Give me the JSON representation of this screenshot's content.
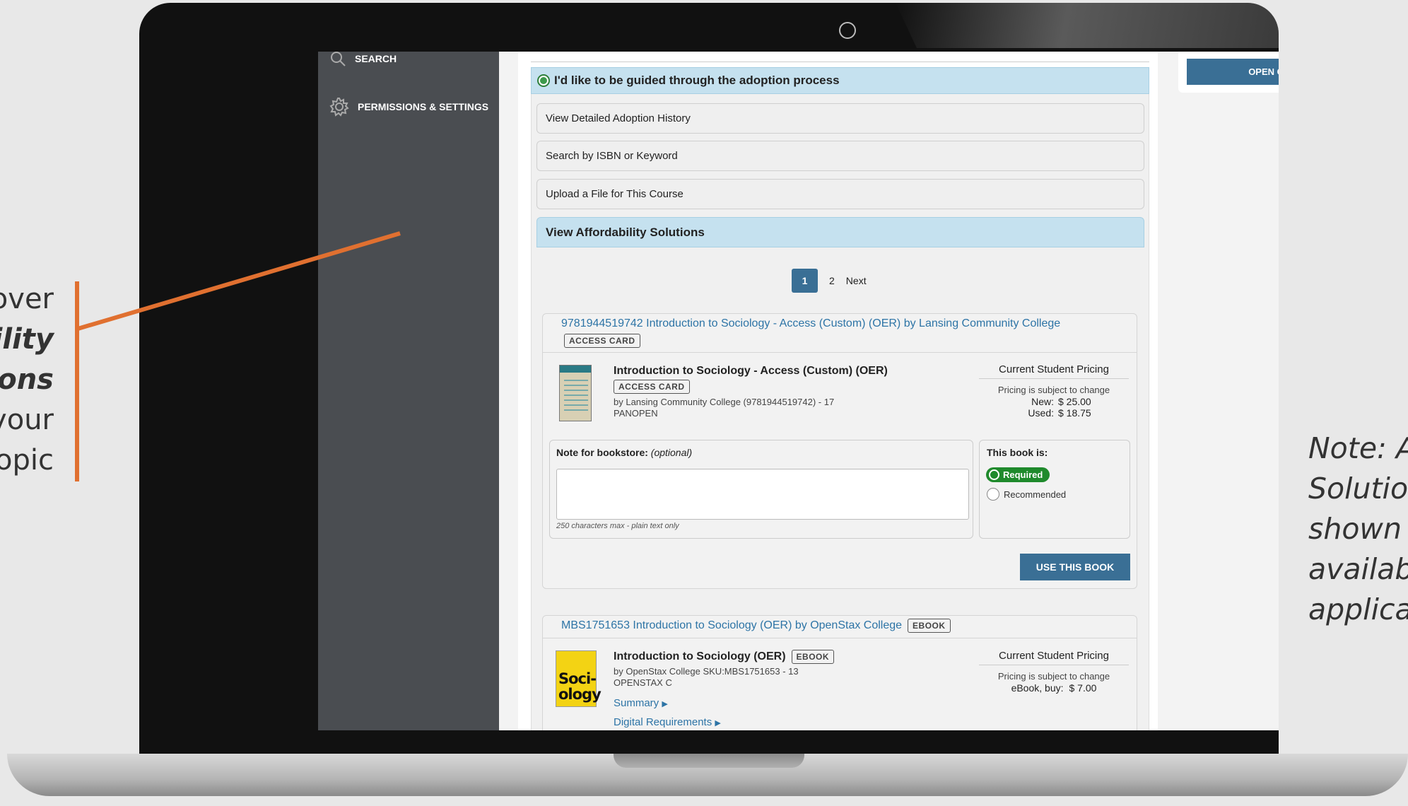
{
  "annotation_left": {
    "lines": [
      "over",
      "ility",
      "ions",
      "your",
      "opic"
    ]
  },
  "annotation_right": {
    "lines": [
      "Note: A",
      "Solutior",
      "shown i",
      "availab",
      "applica"
    ]
  },
  "sidebar": {
    "items": [
      {
        "label": "SEARCH",
        "icon": "search-icon"
      },
      {
        "label": "PERMISSIONS & SETTINGS",
        "icon": "gear-icon"
      }
    ]
  },
  "chat": {
    "button_label": "OPEN CHAT"
  },
  "guided": {
    "label": "I'd like to be guided through the adoption process",
    "selected": true
  },
  "options": [
    {
      "label": "View Detailed Adoption History"
    },
    {
      "label": "Search by ISBN or Keyword"
    },
    {
      "label": "Upload a File for This Course"
    },
    {
      "label": "View Affordability Solutions",
      "active": true
    }
  ],
  "pagination": {
    "current": "1",
    "pages": [
      "2"
    ],
    "next": "Next"
  },
  "results": [
    {
      "header_title": "9781944519742  Introduction to Sociology - Access (Custom) (OER) by Lansing Community College",
      "header_tag": "ACCESS CARD",
      "book_title": "Introduction to Sociology - Access (Custom) (OER)",
      "book_tag": "ACCESS CARD",
      "meta_line1": "by Lansing Community College (9781944519742) - 17",
      "meta_line2": "PANOPEN",
      "pricing_heading": "Current Student Pricing",
      "pricing_note": "Pricing is subject to change",
      "prices": [
        {
          "label": "New:",
          "value": "$ 25.00"
        },
        {
          "label": "Used:",
          "value": "$ 18.75"
        }
      ],
      "note_label": "Note for bookstore:",
      "note_optional": "(optional)",
      "note_value": "",
      "note_hint": "250 characters max - plain text only",
      "book_is_label": "This book is:",
      "required_label": "Required",
      "recommended_label": "Recommended",
      "selected": "Required",
      "use_button": "USE THIS BOOK"
    },
    {
      "header_title": "MBS1751653  Introduction to Sociology (OER) by OpenStax College",
      "header_tag": "EBOOK",
      "book_title": "Introduction to Sociology (OER)",
      "book_tag": "EBOOK",
      "meta_line1": "by OpenStax College SKU:MBS1751653 - 13",
      "meta_line2": "OPENSTAX C",
      "cover_text_1": "Soci-",
      "cover_text_2": "ology",
      "pricing_heading": "Current Student Pricing",
      "pricing_note": "Pricing is subject to change",
      "prices": [
        {
          "label": "eBook, buy:",
          "value": "$ 7.00"
        }
      ],
      "links": [
        "Summary",
        "Digital Requirements"
      ]
    }
  ],
  "colors": {
    "accent_orange": "#e07030",
    "button_blue": "#3a6f95",
    "link_blue": "#2d74a6",
    "active_option": "#c5e1ef",
    "required_green": "#1f8a2c",
    "sidebar": "#4a4d51"
  }
}
